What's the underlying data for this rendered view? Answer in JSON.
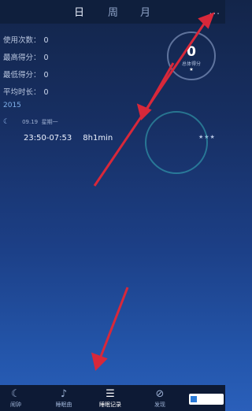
{
  "tabs": [
    {
      "label": "日",
      "active": true
    },
    {
      "label": "周",
      "active": false
    },
    {
      "label": "月",
      "active": false
    }
  ],
  "menu_icon": "...",
  "stats": [
    {
      "label": "使用次数：",
      "value": "0"
    },
    {
      "label": "最高得分：",
      "value": "0"
    },
    {
      "label": "最低得分：",
      "value": "0"
    },
    {
      "label": "平均时长：",
      "value": "0"
    }
  ],
  "score": {
    "value": "0",
    "label": "总体得分",
    "dot": "★"
  },
  "year": "2015",
  "record": {
    "date": "09.19",
    "weekday": "星期一",
    "time_range": "23:50-07:53",
    "duration": "8h1min",
    "stars": "★★★"
  },
  "nav": [
    {
      "label": "闹钟",
      "icon": "moon-icon",
      "glyph": "☾",
      "active": false
    },
    {
      "label": "睡眠曲",
      "icon": "music-icon",
      "glyph": "♪",
      "active": false
    },
    {
      "label": "睡眠记录",
      "icon": "record-icon",
      "glyph": "☰",
      "active": true
    },
    {
      "label": "发现",
      "icon": "compass-icon",
      "glyph": "⊘",
      "active": false
    }
  ],
  "colors": {
    "arrow": "#d8283a",
    "accent": "#7fb0ea",
    "seal": "#3cd2d2"
  }
}
